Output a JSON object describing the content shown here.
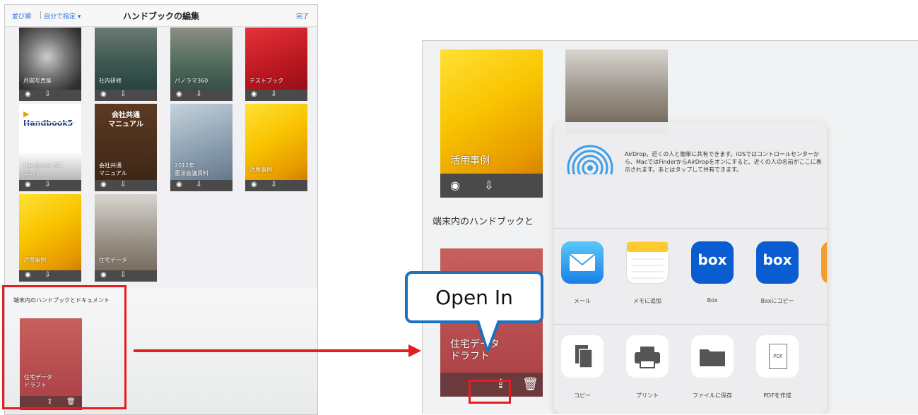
{
  "left_panel": {
    "topbar": {
      "sort_label": "並び順",
      "custom_label": "自分で指定 ▾",
      "title": "ハンドブックの編集",
      "done": "完了"
    },
    "books": [
      {
        "label": "月間写真集",
        "style": "sphere"
      },
      {
        "label": "社内研修",
        "style": "sea"
      },
      {
        "label": "パノラマ360",
        "style": "sea2"
      },
      {
        "label": "テストブック",
        "style": "red"
      },
      {
        "label": "Handbook 5に\nついて",
        "style": "hb",
        "brand": "Handbook5"
      },
      {
        "label": "会社共通\nマニュアル",
        "style": "brown",
        "cover_title": "会社共通\nマニュアル"
      },
      {
        "label": "2012年\n憲法会議資料",
        "style": "office"
      },
      {
        "label": "活用事例",
        "style": "gold"
      },
      {
        "label": "活用事例",
        "style": "gold"
      },
      {
        "label": "住宅データ",
        "style": "vintage"
      }
    ],
    "local_section": {
      "title": "端末内のハンドブックとドキュメント",
      "book_label": "住宅データ\nドラフト"
    }
  },
  "right_panel": {
    "book1_label": "活用事例",
    "section_title": "端末内のハンドブックと",
    "book3_label": "住宅データ\nドラフト",
    "airdrop_text": "AirDrop。近くの人と簡単に共有できます。iOSではコントロールセンターから、MacではFinderからAirDropをオンにすると、近くの人の名前がここに表示されます。あとはタップして共有できます。",
    "apps": [
      {
        "label": "メール",
        "icon": "mail-icon"
      },
      {
        "label": "メモに追加",
        "icon": "notes-icon"
      },
      {
        "label": "Box",
        "icon": "box-icon",
        "text": "box"
      },
      {
        "label": "Boxにコピー",
        "icon": "box-icon",
        "text": "box"
      }
    ],
    "actions": [
      {
        "label": "コピー",
        "icon": "copy-icon"
      },
      {
        "label": "プリント",
        "icon": "print-icon"
      },
      {
        "label": "ファイルに保存",
        "icon": "folder-icon"
      },
      {
        "label": "PDFを作成",
        "icon": "pdf-icon",
        "text": "PDF"
      }
    ]
  },
  "callout": {
    "label": "Open In"
  },
  "colors": {
    "accent": "#2a6fd6",
    "highlight": "#e41e1e",
    "callout_border": "#1a73c1",
    "box_blue": "#0a5cd1"
  }
}
